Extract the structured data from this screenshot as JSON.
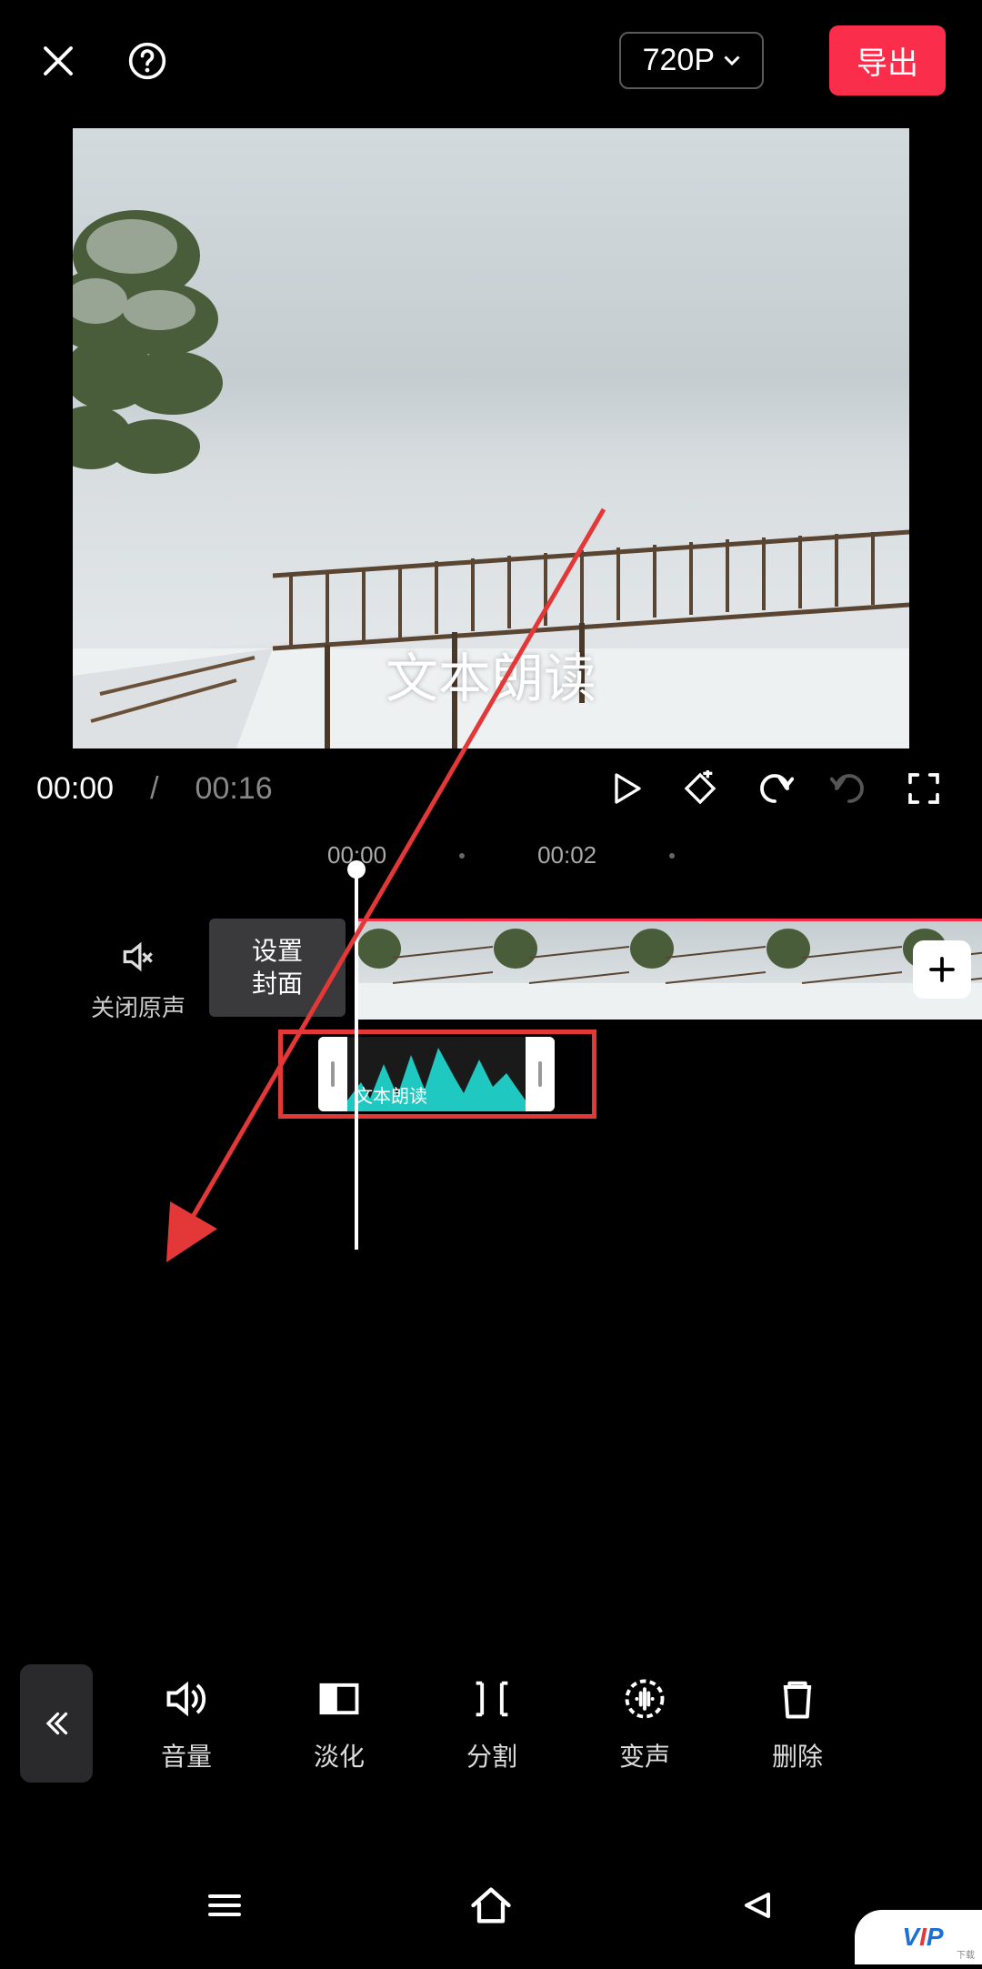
{
  "header": {
    "resolution": "720P",
    "export_label": "导出"
  },
  "preview": {
    "overlay_text": "文本朗读"
  },
  "playback": {
    "current_time": "00:00",
    "total_time": "00:16"
  },
  "ruler": {
    "marks": [
      "00:00",
      "00:02"
    ]
  },
  "timeline": {
    "mute_label": "关闭原声",
    "cover_label_line1": "设置",
    "cover_label_line2": "封面",
    "audio_clip_label": "文本朗读"
  },
  "toolbar": {
    "items": [
      {
        "id": "volume",
        "label": "音量"
      },
      {
        "id": "fade",
        "label": "淡化"
      },
      {
        "id": "split",
        "label": "分割"
      },
      {
        "id": "voice",
        "label": "变声"
      },
      {
        "id": "delete",
        "label": "删除"
      }
    ]
  },
  "watermark": {
    "text": "VIP",
    "sub": "下载"
  },
  "annotation": {
    "highlight_target": "audio-clip",
    "arrow_target": "volume-tool"
  }
}
